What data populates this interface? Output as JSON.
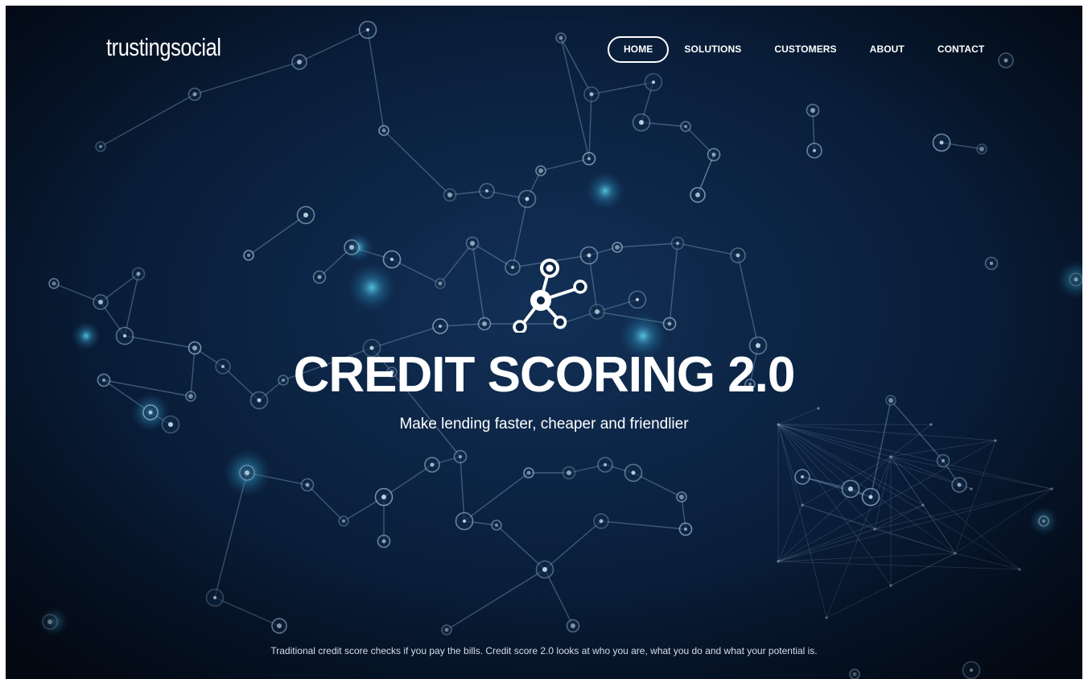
{
  "brand": {
    "logo_text": "trustingsocial"
  },
  "nav": {
    "items": [
      {
        "label": "HOME",
        "active": true
      },
      {
        "label": "SOLUTIONS",
        "active": false
      },
      {
        "label": "CUSTOMERS",
        "active": false
      },
      {
        "label": "ABOUT",
        "active": false
      },
      {
        "label": "CONTACT",
        "active": false
      }
    ]
  },
  "hero": {
    "icon": "network-node-icon",
    "headline": "CREDIT SCORING 2.0",
    "subheadline": "Make lending faster, cheaper and friendlier",
    "background": "network-constellation-background"
  },
  "footer": {
    "tagline": "Traditional credit score checks if you pay the bills. Credit score 2.0 looks at who you are, what you do and what your potential is."
  },
  "colors": {
    "background": "#0a2140",
    "text": "#ffffff",
    "node": "#8fb3d6",
    "glow": "#4fc3e0"
  }
}
